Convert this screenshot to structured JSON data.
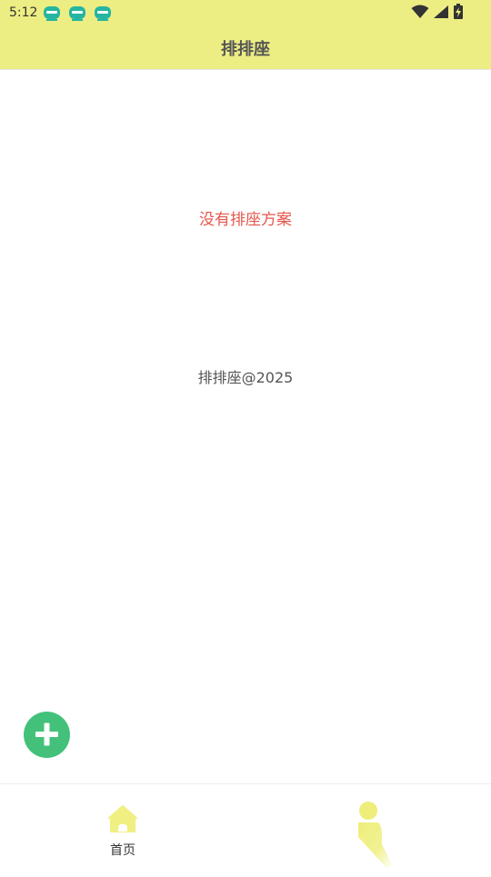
{
  "status_bar": {
    "time": "5:12",
    "notification_icons": [
      "app-notification-icon",
      "app-notification-icon",
      "app-notification-icon"
    ],
    "right_icons": [
      "wifi-icon",
      "cell-signal-icon",
      "battery-charging-icon"
    ]
  },
  "app_bar": {
    "title": "排排座"
  },
  "main": {
    "empty_message": "没有排座方案",
    "copyright": "排排座@2025"
  },
  "fab": {
    "icon": "plus-icon"
  },
  "bottom_nav": {
    "items": [
      {
        "label": "首页",
        "icon": "home-icon"
      },
      {
        "label": "",
        "icon": "profile-icon"
      }
    ]
  },
  "colors": {
    "accent": "#ecee84",
    "icon_yellow": "#f0ef82",
    "fab_green": "#43c17a",
    "empty_text_red": "#e5574b",
    "notif_teal": "#26b5a0"
  }
}
